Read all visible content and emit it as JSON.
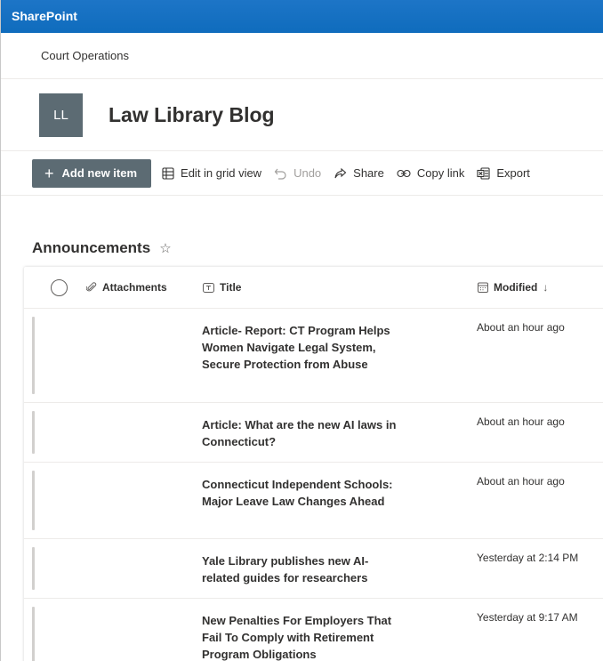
{
  "suitebar": {
    "app_name": "SharePoint"
  },
  "hub": {
    "name": "Court Operations"
  },
  "site": {
    "logo_initials": "LL",
    "title": "Law Library Blog"
  },
  "commandbar": {
    "add_new_item": "Add new item",
    "edit_grid": "Edit in grid view",
    "undo": "Undo",
    "share": "Share",
    "copy_link": "Copy link",
    "export": "Export"
  },
  "list": {
    "title": "Announcements",
    "columns": {
      "attachments": "Attachments",
      "title": "Title",
      "modified": "Modified"
    },
    "rows": [
      {
        "title": "Article- Report: CT Program Helps Women Navigate Legal System, Secure Protection from Abuse",
        "modified": "About an hour ago"
      },
      {
        "title": "Article: What are the new AI laws in Connecticut?",
        "modified": "About an hour ago"
      },
      {
        "title": "Connecticut Independent Schools: Major Leave Law Changes Ahead",
        "modified": "About an hour ago"
      },
      {
        "title": "Yale Library publishes new AI-related guides for researchers",
        "modified": "Yesterday at 2:14 PM"
      },
      {
        "title": "New Penalties For Employers That Fail To Comply with Retirement Program Obligations",
        "modified": "Yesterday at 9:17 AM"
      }
    ]
  },
  "colors": {
    "suitebar": "#0f6cbd",
    "theme_button": "#5c6b73"
  }
}
